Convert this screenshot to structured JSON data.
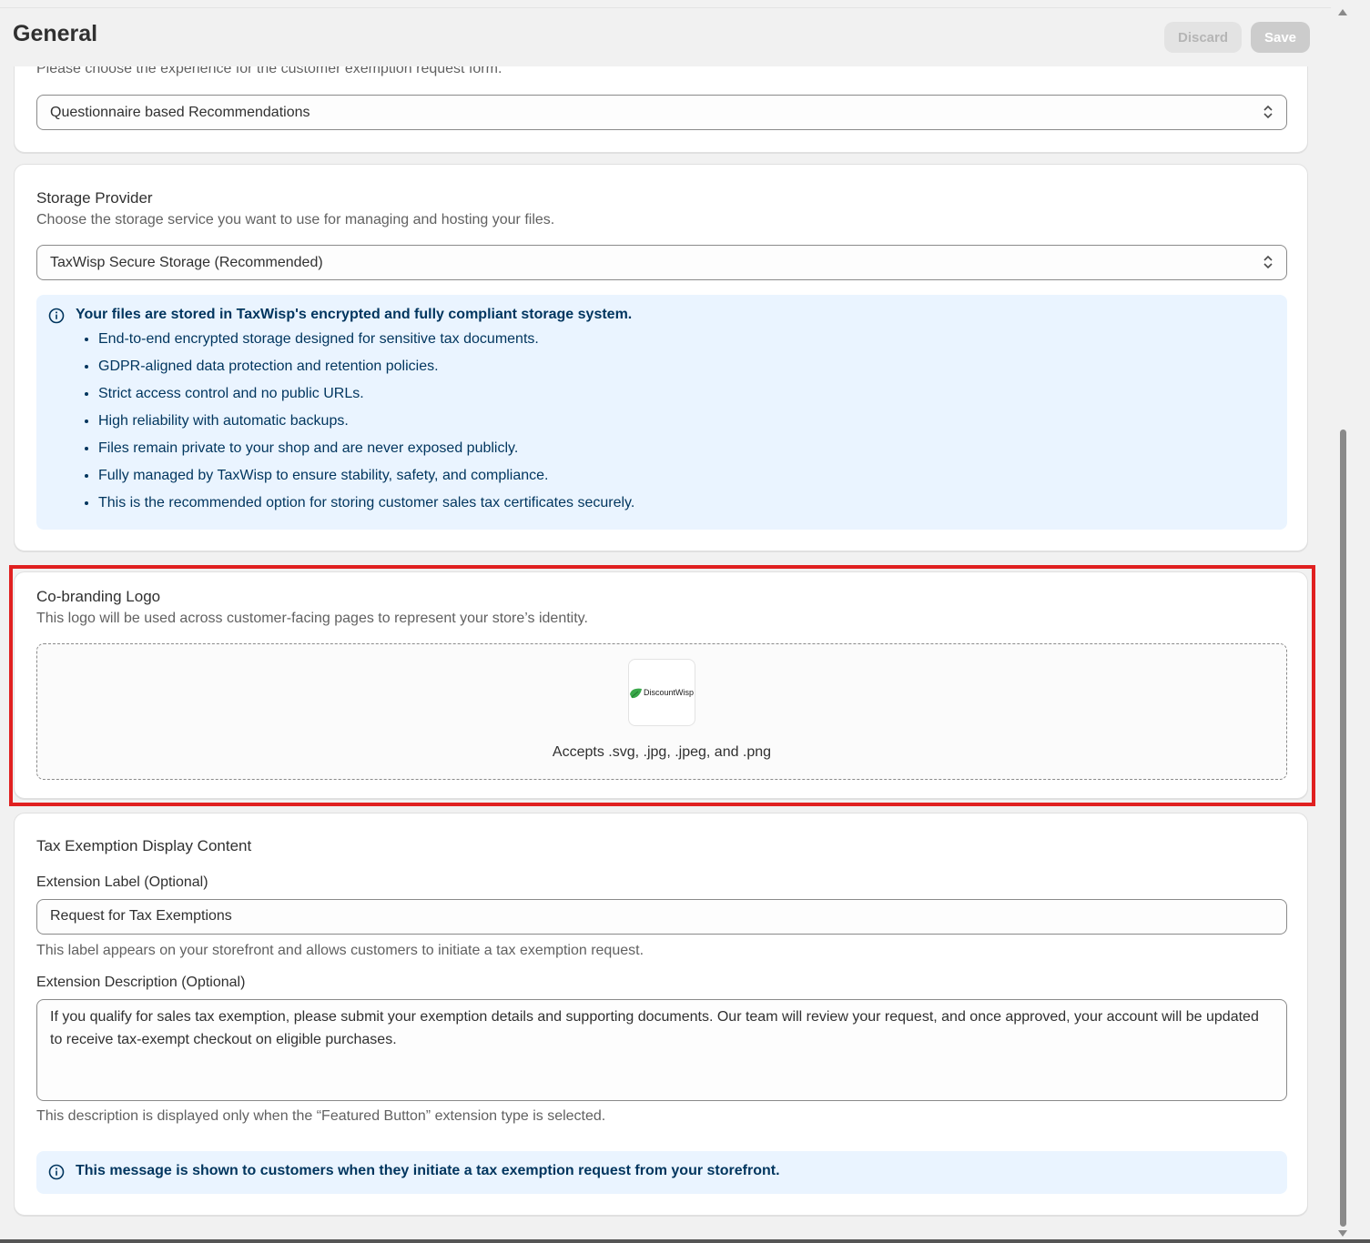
{
  "header": {
    "title": "General",
    "discard_label": "Discard",
    "save_label": "Save"
  },
  "experience_section": {
    "description": "Please choose the experience for the customer exemption request form.",
    "selected": "Questionnaire based Recommendations"
  },
  "storage_section": {
    "title": "Storage Provider",
    "description": "Choose the storage service you want to use for managing and hosting your files.",
    "selected": "TaxWisp Secure Storage (Recommended)",
    "banner": {
      "title": "Your files are stored in TaxWisp's encrypted and fully compliant storage system.",
      "items": [
        "End-to-end encrypted storage designed for sensitive tax documents.",
        "GDPR-aligned data protection and retention policies.",
        "Strict access control and no public URLs.",
        "High reliability with automatic backups.",
        "Files remain private to your shop and are never exposed publicly.",
        "Fully managed by TaxWisp to ensure stability, safety, and compliance.",
        "This is the recommended option for storing customer sales tax certificates securely."
      ]
    }
  },
  "logo_section": {
    "title": "Co-branding Logo",
    "description": "This logo will be used across customer-facing pages to represent your store’s identity.",
    "logo_text": "DiscountWisp",
    "accepts": "Accepts .svg, .jpg, .jpeg, and .png"
  },
  "display_section": {
    "title": "Tax Exemption Display Content",
    "label_field": {
      "label": "Extension Label (Optional)",
      "value": "Request for Tax Exemptions",
      "help": "This label appears on your storefront and allows customers to initiate a tax exemption request."
    },
    "description_field": {
      "label": "Extension Description (Optional)",
      "value": "If you qualify for sales tax exemption, please submit your exemption details and supporting documents. Our team will review your request, and once approved, your account will be updated to receive tax-exempt checkout on eligible purchases.",
      "help": "This description is displayed only when the “Featured Button” extension type is selected."
    },
    "banner": {
      "title": "This message is shown to customers when they initiate a tax exemption request from your storefront."
    }
  },
  "colors": {
    "highlight": "#e02020",
    "info_banner_bg": "#eaf4ff",
    "info_text": "#00355e",
    "logo_green": "#3aa84a"
  }
}
